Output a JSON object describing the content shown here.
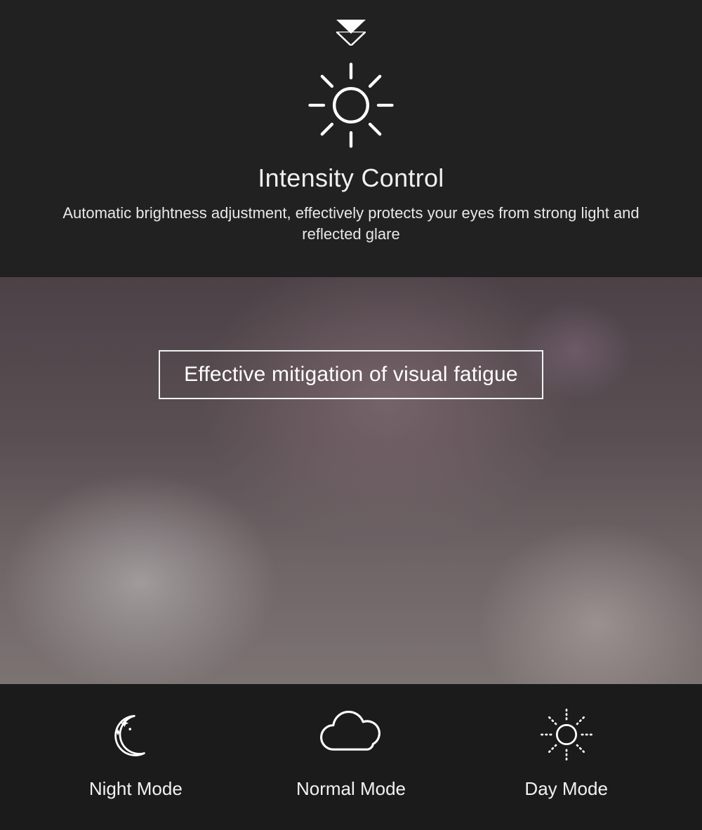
{
  "header": {
    "title": "Intensity Control",
    "subtitle": "Automatic brightness adjustment, effectively protects your eyes from strong light and reflected glare"
  },
  "hero": {
    "overlay_text": "Effective mitigation of visual fatigue"
  },
  "modes": [
    {
      "label": "Night Mode",
      "icon": "moon-stars-icon"
    },
    {
      "label": "Normal Mode",
      "icon": "cloud-icon"
    },
    {
      "label": "Day Mode",
      "icon": "sun-icon"
    }
  ]
}
